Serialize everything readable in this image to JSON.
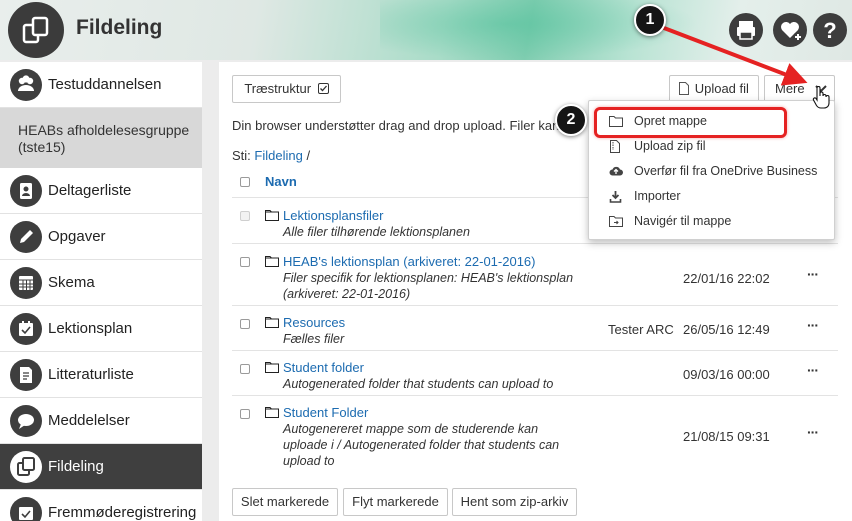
{
  "header": {
    "title": "Fildeling"
  },
  "header_icons": [
    {
      "name": "print-icon"
    },
    {
      "name": "favorite-add-icon"
    },
    {
      "name": "help-icon"
    }
  ],
  "sidebar": {
    "course": "Testuddannelsen",
    "group": "HEABs afholdelesesgruppe (tste15)",
    "items": [
      {
        "label": "Deltagerliste",
        "icon": "participants-icon"
      },
      {
        "label": "Opgaver",
        "icon": "pencil-icon"
      },
      {
        "label": "Skema",
        "icon": "calendar-icon"
      },
      {
        "label": "Lektionsplan",
        "icon": "lesson-plan-icon"
      },
      {
        "label": "Litteraturliste",
        "icon": "literature-icon"
      },
      {
        "label": "Meddelelser",
        "icon": "speech-bubble-icon"
      },
      {
        "label": "Fildeling",
        "icon": "folder-icon",
        "active": true
      },
      {
        "label": "Fremmøderegistrering",
        "icon": "attendance-icon"
      }
    ]
  },
  "toolbar": {
    "tree_label": "Træstruktur",
    "upload_label": "Upload fil",
    "more_label": "Mere"
  },
  "info_text": "Din browser understøtter drag and drop upload. Filer kan",
  "path": {
    "label": "Sti:",
    "root": "Fildeling",
    "sep": "/"
  },
  "table": {
    "name_header": "Navn",
    "rows": [
      {
        "name": "Lektionsplansfiler",
        "desc": "Alle filer tilhørende lektionsplanen",
        "owner": "",
        "date": "",
        "disabled": true
      },
      {
        "name": "HEAB's lektionsplan (arkiveret: 22-01-2016)",
        "desc": "Filer specifik for lektionsplanen: HEAB's lektionsplan (arkiveret: 22-01-2016)",
        "owner": "",
        "date": "22/01/16 22:02"
      },
      {
        "name": "Resources",
        "desc": "Fælles filer",
        "owner": "Tester ARC",
        "date": "26/05/16 12:49"
      },
      {
        "name": "Student folder",
        "desc": "Autogenerated folder that students can upload to",
        "owner": "",
        "date": "09/03/16 00:00"
      },
      {
        "name": "Student Folder",
        "desc": "Autogenereret mappe som de studerende kan uploade i / Autogenerated folder that students can upload to",
        "owner": "",
        "date": "21/08/15 09:31"
      }
    ],
    "more_glyph": "···"
  },
  "bulk_actions": {
    "delete_label": "Slet markerede",
    "move_label": "Flyt markerede",
    "zip_label": "Hent som zip-arkiv"
  },
  "dropdown": {
    "items": [
      {
        "label": "Opret mappe",
        "icon": "folder-outline-icon"
      },
      {
        "label": "Upload zip fil",
        "icon": "zip-file-icon"
      },
      {
        "label": "Overfør fil fra OneDrive Business",
        "icon": "cloud-upload-icon"
      },
      {
        "label": "Importer",
        "icon": "import-icon"
      },
      {
        "label": "Navigér til mappe",
        "icon": "folder-navigate-icon"
      }
    ]
  },
  "callouts": [
    "1",
    "2"
  ],
  "colors": {
    "accent": "#1c6bb0",
    "callout_red": "#e52222",
    "dark": "#3e3e3e"
  }
}
